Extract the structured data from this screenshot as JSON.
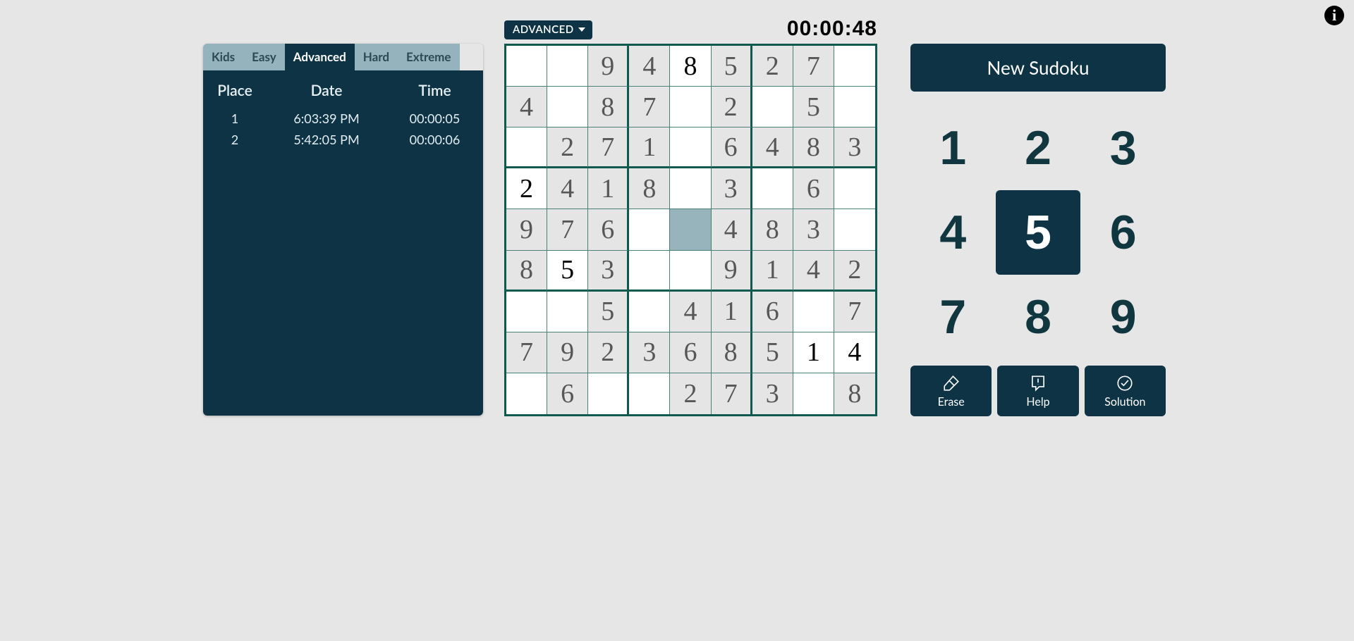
{
  "info_icon": "i",
  "difficulty": {
    "label": "ADVANCED"
  },
  "timer": "00:00:48",
  "tabs": [
    "Kids",
    "Easy",
    "Advanced",
    "Hard",
    "Extreme"
  ],
  "active_tab": 2,
  "score": {
    "headers": {
      "place": "Place",
      "date": "Date",
      "time": "Time"
    },
    "rows": [
      {
        "place": "1",
        "date": "6:03:39 PM",
        "time": "00:00:05"
      },
      {
        "place": "2",
        "date": "5:42:05 PM",
        "time": "00:00:06"
      }
    ]
  },
  "grid": [
    [
      {
        "v": null
      },
      {
        "v": null
      },
      {
        "v": 9,
        "g": true
      },
      {
        "v": 4,
        "g": true
      },
      {
        "v": 8,
        "u": true
      },
      {
        "v": 5,
        "g": true
      },
      {
        "v": 2,
        "g": true
      },
      {
        "v": 7,
        "g": true
      },
      {
        "v": null
      }
    ],
    [
      {
        "v": 4,
        "g": true
      },
      {
        "v": null
      },
      {
        "v": 8,
        "g": true
      },
      {
        "v": 7,
        "g": true
      },
      {
        "v": null
      },
      {
        "v": 2,
        "g": true
      },
      {
        "v": null
      },
      {
        "v": 5,
        "g": true
      },
      {
        "v": null
      }
    ],
    [
      {
        "v": null
      },
      {
        "v": 2,
        "g": true
      },
      {
        "v": 7,
        "g": true
      },
      {
        "v": 1,
        "g": true
      },
      {
        "v": null
      },
      {
        "v": 6,
        "g": true
      },
      {
        "v": 4,
        "g": true
      },
      {
        "v": 8,
        "g": true
      },
      {
        "v": 3,
        "g": true
      }
    ],
    [
      {
        "v": 2,
        "u": true
      },
      {
        "v": 4,
        "g": true
      },
      {
        "v": 1,
        "g": true
      },
      {
        "v": 8,
        "g": true
      },
      {
        "v": null
      },
      {
        "v": 3,
        "g": true
      },
      {
        "v": null
      },
      {
        "v": 6,
        "g": true
      },
      {
        "v": null
      }
    ],
    [
      {
        "v": 9,
        "g": true
      },
      {
        "v": 7,
        "g": true
      },
      {
        "v": 6,
        "g": true
      },
      {
        "v": null
      },
      {
        "v": null,
        "sel": true
      },
      {
        "v": 4,
        "g": true
      },
      {
        "v": 8,
        "g": true
      },
      {
        "v": 3,
        "g": true
      },
      {
        "v": null
      }
    ],
    [
      {
        "v": 8,
        "g": true
      },
      {
        "v": 5,
        "u": true
      },
      {
        "v": 3,
        "g": true
      },
      {
        "v": null
      },
      {
        "v": null
      },
      {
        "v": 9,
        "g": true
      },
      {
        "v": 1,
        "g": true
      },
      {
        "v": 4,
        "g": true
      },
      {
        "v": 2,
        "g": true
      }
    ],
    [
      {
        "v": null
      },
      {
        "v": null
      },
      {
        "v": 5,
        "g": true
      },
      {
        "v": null
      },
      {
        "v": 4,
        "g": true
      },
      {
        "v": 1,
        "g": true
      },
      {
        "v": 6,
        "g": true
      },
      {
        "v": null
      },
      {
        "v": 7,
        "g": true
      }
    ],
    [
      {
        "v": 7,
        "g": true
      },
      {
        "v": 9,
        "g": true
      },
      {
        "v": 2,
        "g": true
      },
      {
        "v": 3,
        "g": true
      },
      {
        "v": 6,
        "g": true
      },
      {
        "v": 8,
        "g": true
      },
      {
        "v": 5,
        "g": true
      },
      {
        "v": 1,
        "u": true
      },
      {
        "v": 4,
        "u": true
      }
    ],
    [
      {
        "v": null
      },
      {
        "v": 6,
        "g": true
      },
      {
        "v": null
      },
      {
        "v": null
      },
      {
        "v": 2,
        "g": true
      },
      {
        "v": 7,
        "g": true
      },
      {
        "v": 3,
        "g": true
      },
      {
        "v": null
      },
      {
        "v": 8,
        "g": true
      }
    ]
  ],
  "new_button": "New Sudoku",
  "numpad": [
    "1",
    "2",
    "3",
    "4",
    "5",
    "6",
    "7",
    "8",
    "9"
  ],
  "numpad_selected": 4,
  "actions": {
    "erase": "Erase",
    "help": "Help",
    "solution": "Solution"
  }
}
